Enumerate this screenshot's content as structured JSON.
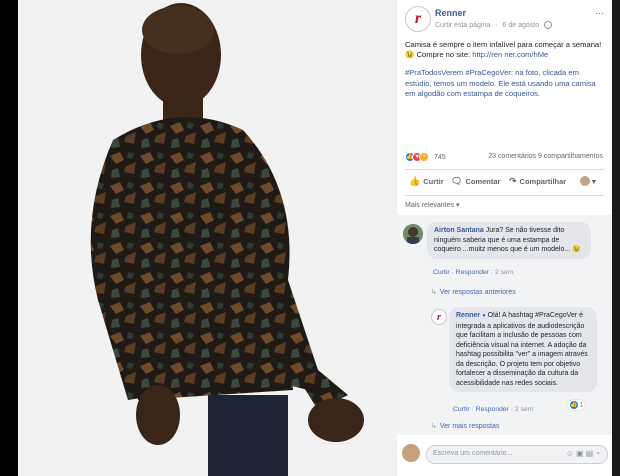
{
  "post": {
    "page_name": "Renner",
    "follow_label": "Curtir esta página",
    "date": "6 de agosto",
    "more_icon": "ellipsis-icon",
    "text_line1": "Camisa é sempre o item infalível para começar a semana! 😉 Compre no site: ",
    "link": "http://ren ner.com/hMe",
    "text_line2": "#PraTodosVerem #PraCegoVer: na foto, clicada em estúdio, temos um modelo. Ele está usando uma camisa em algodão com estampa de coqueiros."
  },
  "reactions": {
    "count": "745",
    "comments": "23 comentários",
    "shares": "9 compartilhamentos",
    "colors": {
      "like": "#1877f2",
      "love": "#f33e58",
      "wow": "#f7b125"
    }
  },
  "actions": {
    "like": "Curtir",
    "comment": "Comentar",
    "share": "Compartilhar"
  },
  "filter": {
    "label": "Mais relevantes ▾"
  },
  "comments": [
    {
      "author": "Airton Santana",
      "text": "Jura? Se não tivesse dito ninguém saberia que é uma estampa de coqueiro ...muitz menos que é um modelo... 😉",
      "like": "Curtir",
      "reply": "Responder",
      "time": "2 sem",
      "view_replies": "Ver respostas anteriores"
    },
    {
      "author": "Renner",
      "text": "Olá! A hashtag #PraCegoVer é integrada a aplicativos de audiodescrição que facilitam a inclusão de pessoas com deficiência visual na internet. A adoção da hashtag possibilita \"ver\" a imagem através da descrição. O projeto tem por objetivo fortalecer a disseminação da cultura da acessibilidade nas redes sociais.",
      "like": "Curtir",
      "reply": "Responder",
      "time": "2 sem",
      "reaction_count": "1",
      "view_more": "Ver mais respostas"
    }
  ],
  "composer": {
    "placeholder": "Escreva um comentário..."
  }
}
